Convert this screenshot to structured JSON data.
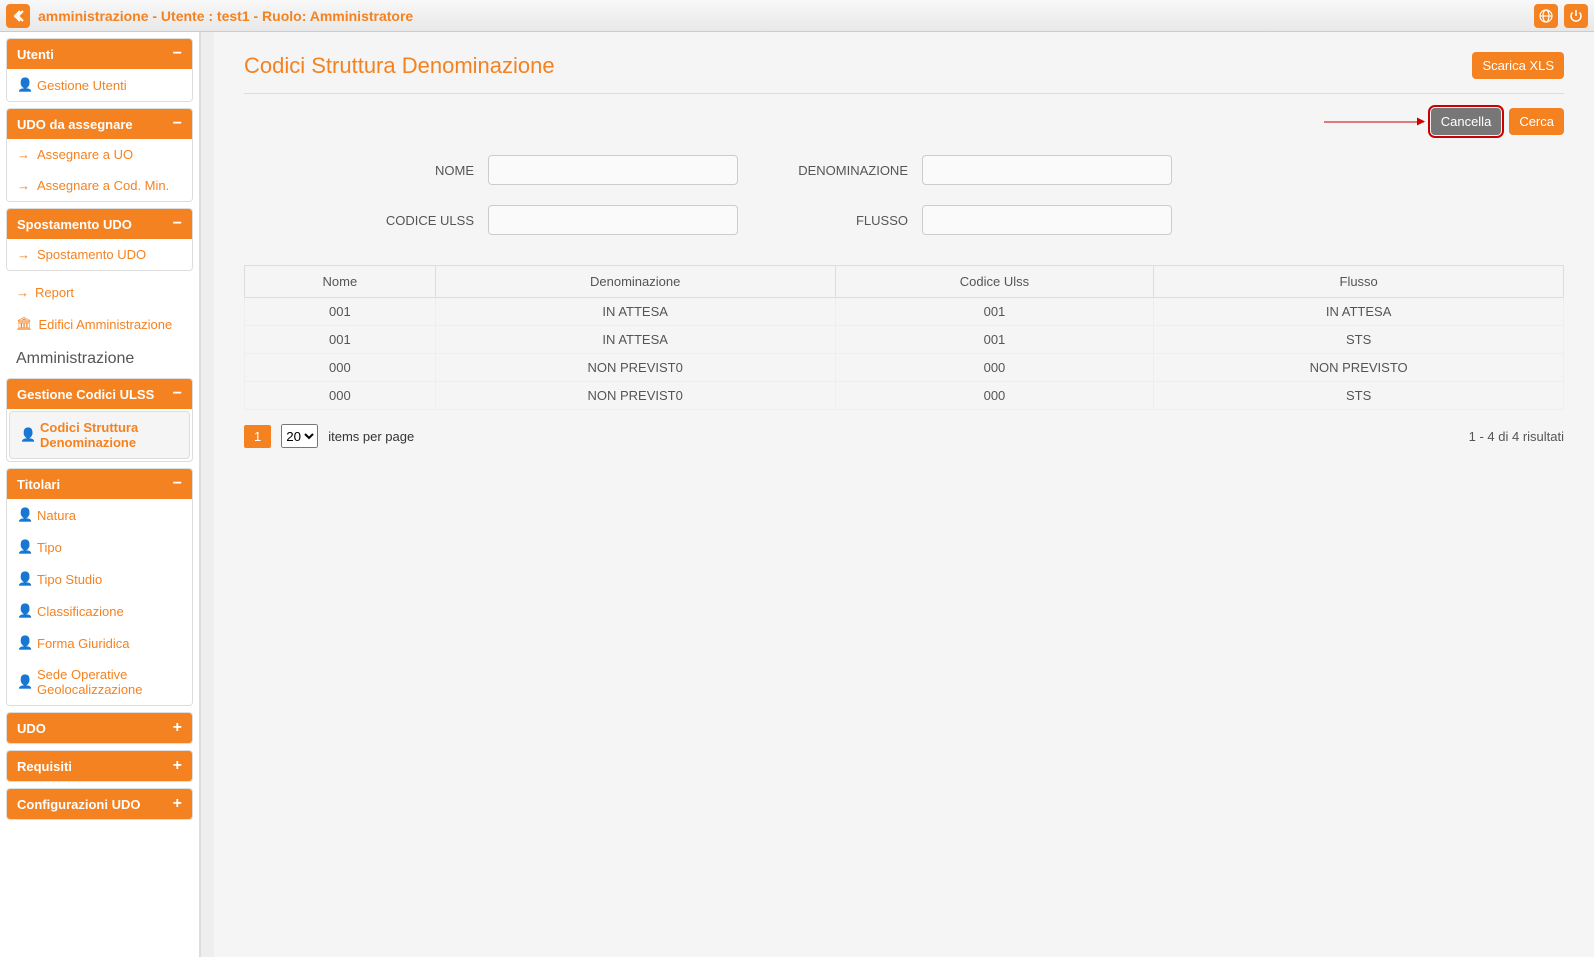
{
  "topbar": {
    "title": "amministrazione - Utente : test1 - Ruolo: Amministratore"
  },
  "sidebar": {
    "utenti": {
      "header": "Utenti",
      "items": [
        "Gestione Utenti"
      ]
    },
    "udo_assegnare": {
      "header": "UDO da assegnare",
      "items": [
        "Assegnare a UO",
        "Assegnare a Cod. Min."
      ]
    },
    "spostamento": {
      "header": "Spostamento UDO",
      "items": [
        "Spostamento UDO"
      ]
    },
    "plain": [
      "Report",
      "Edifici Amministrazione"
    ],
    "section_label": "Amministrazione",
    "gestione_codici": {
      "header": "Gestione Codici ULSS",
      "items": [
        "Codici Struttura Denominazione"
      ]
    },
    "titolari": {
      "header": "Titolari",
      "items": [
        "Natura",
        "Tipo",
        "Tipo Studio",
        "Classificazione",
        "Forma Giuridica",
        "Sede Operative Geolocalizzazione"
      ]
    },
    "collapsed": [
      "UDO",
      "Requisiti",
      "Configurazioni UDO"
    ]
  },
  "main": {
    "title": "Codici Struttura Denominazione",
    "download_btn": "Scarica XLS",
    "cancel_btn": "Cancella",
    "search_btn": "Cerca",
    "labels": {
      "nome": "NOME",
      "denominazione": "DENOMINAZIONE",
      "codice_ulss": "CODICE ULSS",
      "flusso": "FLUSSO"
    },
    "table": {
      "headers": [
        "Nome",
        "Denominazione",
        "Codice Ulss",
        "Flusso"
      ],
      "rows": [
        [
          "001",
          "IN ATTESA",
          "001",
          "IN ATTESA"
        ],
        [
          "001",
          "IN ATTESA",
          "001",
          "STS"
        ],
        [
          "000",
          "NON PREVIST0",
          "000",
          "NON PREVISTO"
        ],
        [
          "000",
          "NON PREVIST0",
          "000",
          "STS"
        ]
      ]
    },
    "pager": {
      "current": "1",
      "page_size": "20",
      "items_label": "items per page",
      "result_info": "1 - 4 di 4 risultati"
    }
  }
}
